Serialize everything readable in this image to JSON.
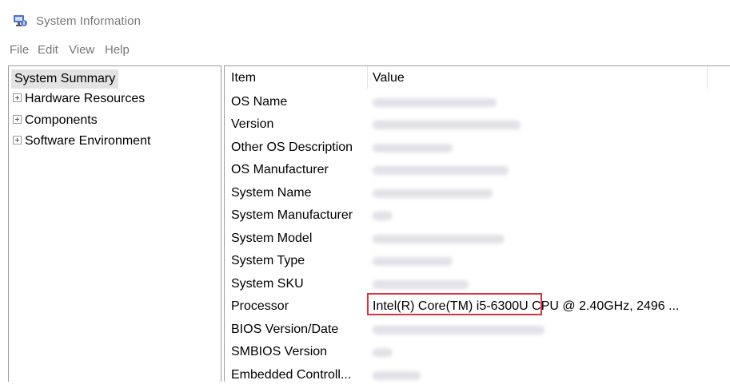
{
  "window": {
    "title": "System Information",
    "icon": "system-information-icon"
  },
  "menu": [
    "File",
    "Edit",
    "View",
    "Help"
  ],
  "tree": {
    "summary": "System Summary",
    "nodes": [
      "Hardware Resources",
      "Components",
      "Software Environment"
    ]
  },
  "table": {
    "headers": {
      "item": "Item",
      "value": "Value"
    },
    "rows": [
      {
        "item": "OS Name",
        "value": ""
      },
      {
        "item": "Version",
        "value": ""
      },
      {
        "item": "Other OS Description",
        "value": ""
      },
      {
        "item": "OS Manufacturer",
        "value": ""
      },
      {
        "item": "System Name",
        "value": ""
      },
      {
        "item": "System Manufacturer",
        "value": ""
      },
      {
        "item": "System Model",
        "value": ""
      },
      {
        "item": "System Type",
        "value": ""
      },
      {
        "item": "System SKU",
        "value": ""
      },
      {
        "item": "Processor",
        "value_highlighted": "Intel(R) Core(TM) i5-6300U",
        "value_rest": " CPU @ 2.40GHz, 2496 ..."
      },
      {
        "item": "BIOS Version/Date",
        "value": ""
      },
      {
        "item": "SMBIOS Version",
        "value": ""
      },
      {
        "item": "Embedded Controll...",
        "value": ""
      }
    ]
  },
  "colors": {
    "highlight_border": "#d9333f",
    "selected_bg": "#e3e3e3"
  }
}
